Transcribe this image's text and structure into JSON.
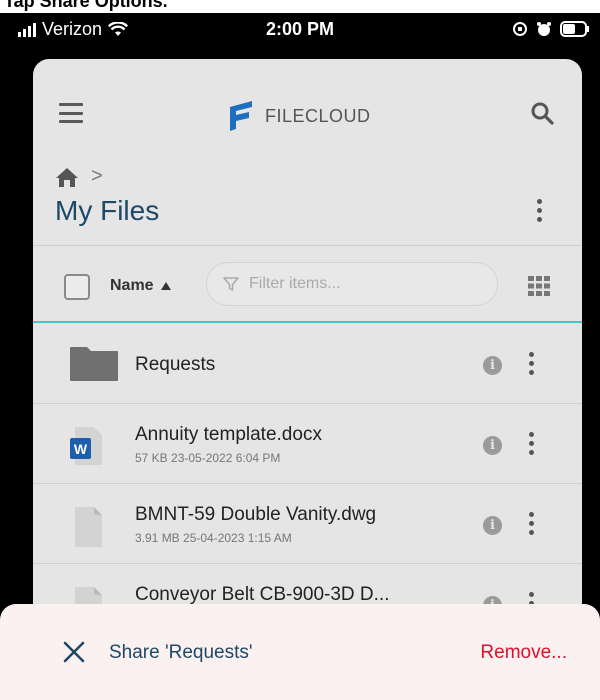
{
  "caption": "Tap Share Options.",
  "status_bar": {
    "carrier": "Verizon",
    "time": "2:00 PM"
  },
  "header": {
    "brand": "FILECLOUD"
  },
  "breadcrumb": {
    "separator": ">"
  },
  "page": {
    "title": "My Files"
  },
  "toolbar": {
    "sort_label": "Name",
    "filter_placeholder": "Filter items..."
  },
  "files": [
    {
      "name": "Requests",
      "type": "folder",
      "meta": ""
    },
    {
      "name": "Annuity template.docx",
      "type": "word",
      "meta": "57 KB 23-05-2022 6:04 PM"
    },
    {
      "name": "BMNT-59 Double Vanity.dwg",
      "type": "file",
      "meta": "3.91 MB 25-04-2023 1:15 AM"
    },
    {
      "name": "Conveyor Belt CB-900-3D D...",
      "type": "file",
      "meta": ""
    }
  ],
  "bottom_sheet": {
    "share_label": "Share 'Requests'",
    "remove_label": "Remove..."
  },
  "colors": {
    "accent": "#3fc6c6",
    "title": "#1c4966",
    "danger": "#e0102a",
    "brand": "#1e6fc2"
  },
  "icons": [
    "hamburger-icon",
    "filecloud-logo-icon",
    "search-icon",
    "home-icon",
    "chevron-right-icon",
    "kebab-icon",
    "sort-asc-icon",
    "filter-icon",
    "grid-view-icon",
    "folder-icon",
    "word-doc-icon",
    "file-icon",
    "info-icon",
    "close-icon"
  ]
}
